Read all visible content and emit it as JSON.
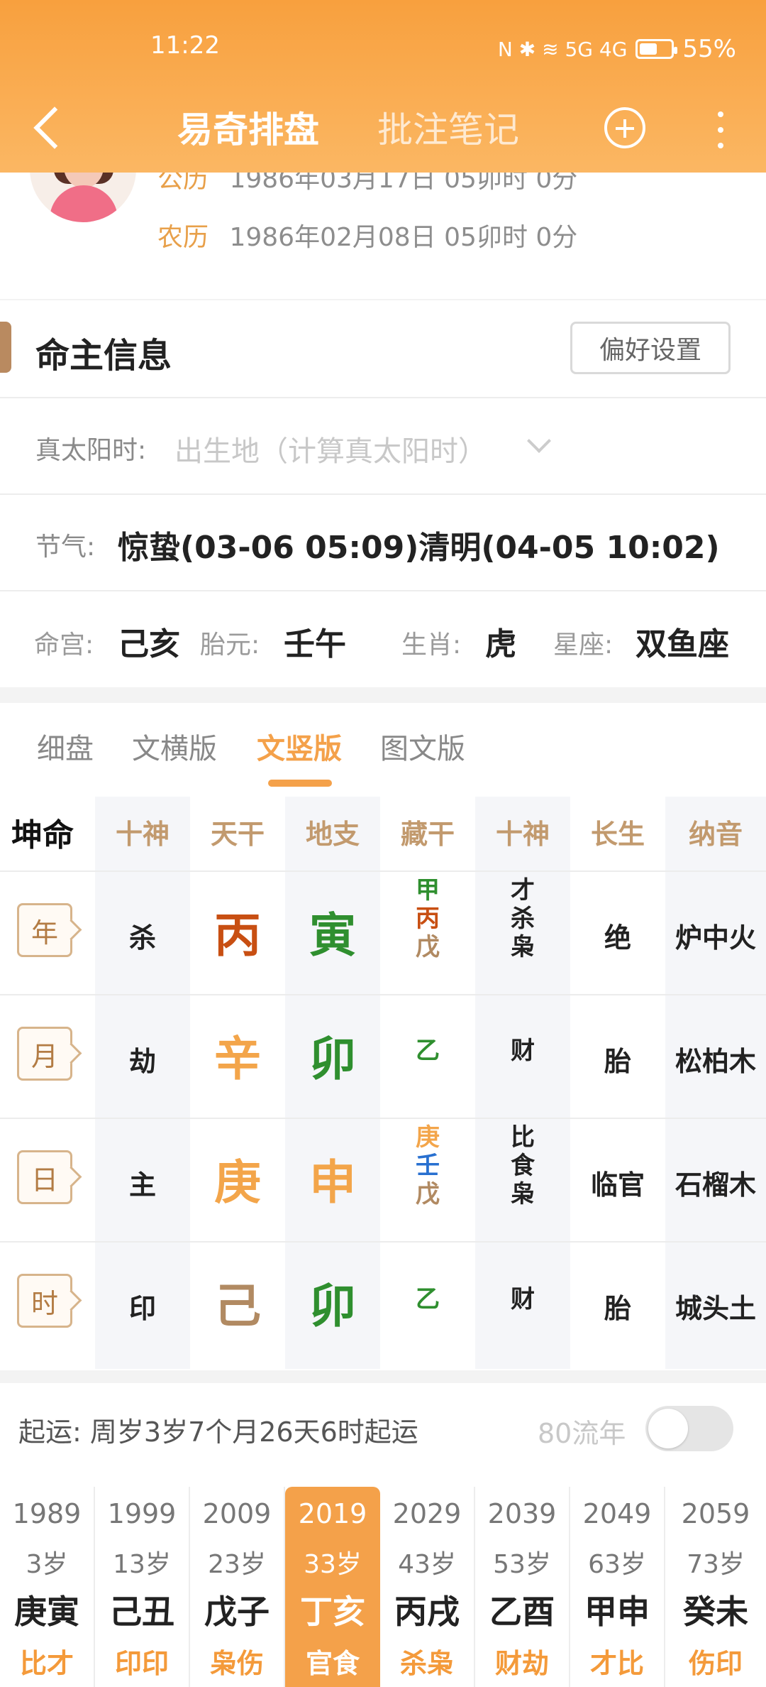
{
  "status": {
    "time": "11:22",
    "network": "N ✱ ≋ 5G 4G",
    "battery": "55%"
  },
  "nav": {
    "title_active": "易奇排盘",
    "title_inactive": "批注笔记"
  },
  "profile": {
    "solar_label": "公历",
    "solar_value": "1986年03月17日 05卯时 0分",
    "lunar_label": "农历",
    "lunar_value": "1986年02月08日 05卯时 0分"
  },
  "info": {
    "title": "命主信息",
    "preference_button": "偏好设置",
    "true_sun_label": "真太阳时:",
    "true_sun_value": "出生地（计算真太阳时）",
    "jieqi_label": "节气:",
    "jieqi_value": "惊蛰(03-06 05:09)清明(04-05 10:02)",
    "minggong_label": "命宫:",
    "minggong_value": "己亥",
    "taiyuan_label": "胎元:",
    "taiyuan_value": "壬午",
    "shengxiao_label": "生肖:",
    "shengxiao_value": "虎",
    "xingzuo_label": "星座:",
    "xingzuo_value": "双鱼座"
  },
  "chart": {
    "tabs": [
      "细盘",
      "文横版",
      "文竖版",
      "图文版"
    ],
    "active_tab": "文竖版",
    "first_header": "坤命",
    "headers": [
      "十神",
      "天干",
      "地支",
      "藏干",
      "十神",
      "长生",
      "纳音"
    ],
    "rows": [
      {
        "pillar": "年",
        "shishen": "杀",
        "tiangan": "丙",
        "dizhi": "寅",
        "canggan": [
          "甲",
          "丙",
          "戊"
        ],
        "shishen2": [
          "才",
          "杀",
          "枭"
        ],
        "changsheng": "绝",
        "nayin": "炉中火"
      },
      {
        "pillar": "月",
        "shishen": "劫",
        "tiangan": "辛",
        "dizhi": "卯",
        "canggan": [
          "乙"
        ],
        "shishen2": [
          "财"
        ],
        "changsheng": "胎",
        "nayin": "松柏木"
      },
      {
        "pillar": "日",
        "shishen": "主",
        "tiangan": "庚",
        "dizhi": "申",
        "canggan": [
          "庚",
          "壬",
          "戊"
        ],
        "shishen2": [
          "比",
          "食",
          "枭"
        ],
        "changsheng": "临官",
        "nayin": "石榴木"
      },
      {
        "pillar": "时",
        "shishen": "印",
        "tiangan": "己",
        "dizhi": "卯",
        "canggan": [
          "乙"
        ],
        "shishen2": [
          "财"
        ],
        "changsheng": "胎",
        "nayin": "城头土"
      }
    ],
    "colors": {
      "wood": "#2f8f2f",
      "fire": "#c84f12",
      "metal": "#f3a54a",
      "earth": "#b18a62",
      "water": "#2870d0"
    }
  },
  "luck": {
    "label": "起运:",
    "text": "周岁3岁7个月26天6时起运",
    "liunian": "80流年",
    "items": [
      {
        "year": "1989",
        "age": "3岁",
        "ganzhi": "庚寅",
        "relation": "比才"
      },
      {
        "year": "1999",
        "age": "13岁",
        "ganzhi": "己丑",
        "relation": "印印"
      },
      {
        "year": "2009",
        "age": "23岁",
        "ganzhi": "戊子",
        "relation": "枭伤"
      },
      {
        "year": "2019",
        "age": "33岁",
        "ganzhi": "丁亥",
        "relation": "官食"
      },
      {
        "year": "2029",
        "age": "43岁",
        "ganzhi": "丙戌",
        "relation": "杀枭"
      },
      {
        "year": "2039",
        "age": "53岁",
        "ganzhi": "乙酉",
        "relation": "财劫"
      },
      {
        "year": "2049",
        "age": "63岁",
        "ganzhi": "甲申",
        "relation": "才比"
      },
      {
        "year": "2059",
        "age": "73岁",
        "ganzhi": "癸未",
        "relation": "伤印"
      }
    ]
  }
}
